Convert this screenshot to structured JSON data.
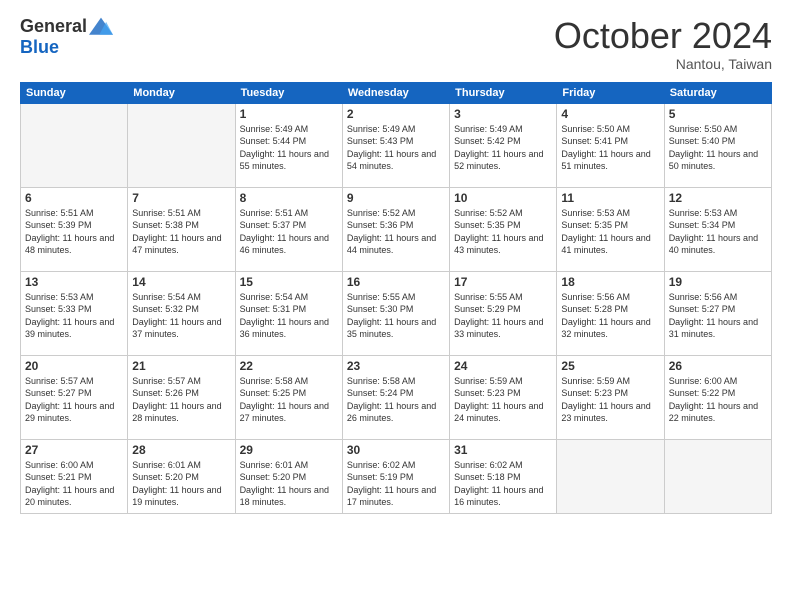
{
  "header": {
    "logo_general": "General",
    "logo_blue": "Blue",
    "month_title": "October 2024",
    "subtitle": "Nantou, Taiwan"
  },
  "days_of_week": [
    "Sunday",
    "Monday",
    "Tuesday",
    "Wednesday",
    "Thursday",
    "Friday",
    "Saturday"
  ],
  "weeks": [
    [
      {
        "day": "",
        "info": ""
      },
      {
        "day": "",
        "info": ""
      },
      {
        "day": "1",
        "info": "Sunrise: 5:49 AM\nSunset: 5:44 PM\nDaylight: 11 hours and 55 minutes."
      },
      {
        "day": "2",
        "info": "Sunrise: 5:49 AM\nSunset: 5:43 PM\nDaylight: 11 hours and 54 minutes."
      },
      {
        "day": "3",
        "info": "Sunrise: 5:49 AM\nSunset: 5:42 PM\nDaylight: 11 hours and 52 minutes."
      },
      {
        "day": "4",
        "info": "Sunrise: 5:50 AM\nSunset: 5:41 PM\nDaylight: 11 hours and 51 minutes."
      },
      {
        "day": "5",
        "info": "Sunrise: 5:50 AM\nSunset: 5:40 PM\nDaylight: 11 hours and 50 minutes."
      }
    ],
    [
      {
        "day": "6",
        "info": "Sunrise: 5:51 AM\nSunset: 5:39 PM\nDaylight: 11 hours and 48 minutes."
      },
      {
        "day": "7",
        "info": "Sunrise: 5:51 AM\nSunset: 5:38 PM\nDaylight: 11 hours and 47 minutes."
      },
      {
        "day": "8",
        "info": "Sunrise: 5:51 AM\nSunset: 5:37 PM\nDaylight: 11 hours and 46 minutes."
      },
      {
        "day": "9",
        "info": "Sunrise: 5:52 AM\nSunset: 5:36 PM\nDaylight: 11 hours and 44 minutes."
      },
      {
        "day": "10",
        "info": "Sunrise: 5:52 AM\nSunset: 5:35 PM\nDaylight: 11 hours and 43 minutes."
      },
      {
        "day": "11",
        "info": "Sunrise: 5:53 AM\nSunset: 5:35 PM\nDaylight: 11 hours and 41 minutes."
      },
      {
        "day": "12",
        "info": "Sunrise: 5:53 AM\nSunset: 5:34 PM\nDaylight: 11 hours and 40 minutes."
      }
    ],
    [
      {
        "day": "13",
        "info": "Sunrise: 5:53 AM\nSunset: 5:33 PM\nDaylight: 11 hours and 39 minutes."
      },
      {
        "day": "14",
        "info": "Sunrise: 5:54 AM\nSunset: 5:32 PM\nDaylight: 11 hours and 37 minutes."
      },
      {
        "day": "15",
        "info": "Sunrise: 5:54 AM\nSunset: 5:31 PM\nDaylight: 11 hours and 36 minutes."
      },
      {
        "day": "16",
        "info": "Sunrise: 5:55 AM\nSunset: 5:30 PM\nDaylight: 11 hours and 35 minutes."
      },
      {
        "day": "17",
        "info": "Sunrise: 5:55 AM\nSunset: 5:29 PM\nDaylight: 11 hours and 33 minutes."
      },
      {
        "day": "18",
        "info": "Sunrise: 5:56 AM\nSunset: 5:28 PM\nDaylight: 11 hours and 32 minutes."
      },
      {
        "day": "19",
        "info": "Sunrise: 5:56 AM\nSunset: 5:27 PM\nDaylight: 11 hours and 31 minutes."
      }
    ],
    [
      {
        "day": "20",
        "info": "Sunrise: 5:57 AM\nSunset: 5:27 PM\nDaylight: 11 hours and 29 minutes."
      },
      {
        "day": "21",
        "info": "Sunrise: 5:57 AM\nSunset: 5:26 PM\nDaylight: 11 hours and 28 minutes."
      },
      {
        "day": "22",
        "info": "Sunrise: 5:58 AM\nSunset: 5:25 PM\nDaylight: 11 hours and 27 minutes."
      },
      {
        "day": "23",
        "info": "Sunrise: 5:58 AM\nSunset: 5:24 PM\nDaylight: 11 hours and 26 minutes."
      },
      {
        "day": "24",
        "info": "Sunrise: 5:59 AM\nSunset: 5:23 PM\nDaylight: 11 hours and 24 minutes."
      },
      {
        "day": "25",
        "info": "Sunrise: 5:59 AM\nSunset: 5:23 PM\nDaylight: 11 hours and 23 minutes."
      },
      {
        "day": "26",
        "info": "Sunrise: 6:00 AM\nSunset: 5:22 PM\nDaylight: 11 hours and 22 minutes."
      }
    ],
    [
      {
        "day": "27",
        "info": "Sunrise: 6:00 AM\nSunset: 5:21 PM\nDaylight: 11 hours and 20 minutes."
      },
      {
        "day": "28",
        "info": "Sunrise: 6:01 AM\nSunset: 5:20 PM\nDaylight: 11 hours and 19 minutes."
      },
      {
        "day": "29",
        "info": "Sunrise: 6:01 AM\nSunset: 5:20 PM\nDaylight: 11 hours and 18 minutes."
      },
      {
        "day": "30",
        "info": "Sunrise: 6:02 AM\nSunset: 5:19 PM\nDaylight: 11 hours and 17 minutes."
      },
      {
        "day": "31",
        "info": "Sunrise: 6:02 AM\nSunset: 5:18 PM\nDaylight: 11 hours and 16 minutes."
      },
      {
        "day": "",
        "info": ""
      },
      {
        "day": "",
        "info": ""
      }
    ]
  ]
}
